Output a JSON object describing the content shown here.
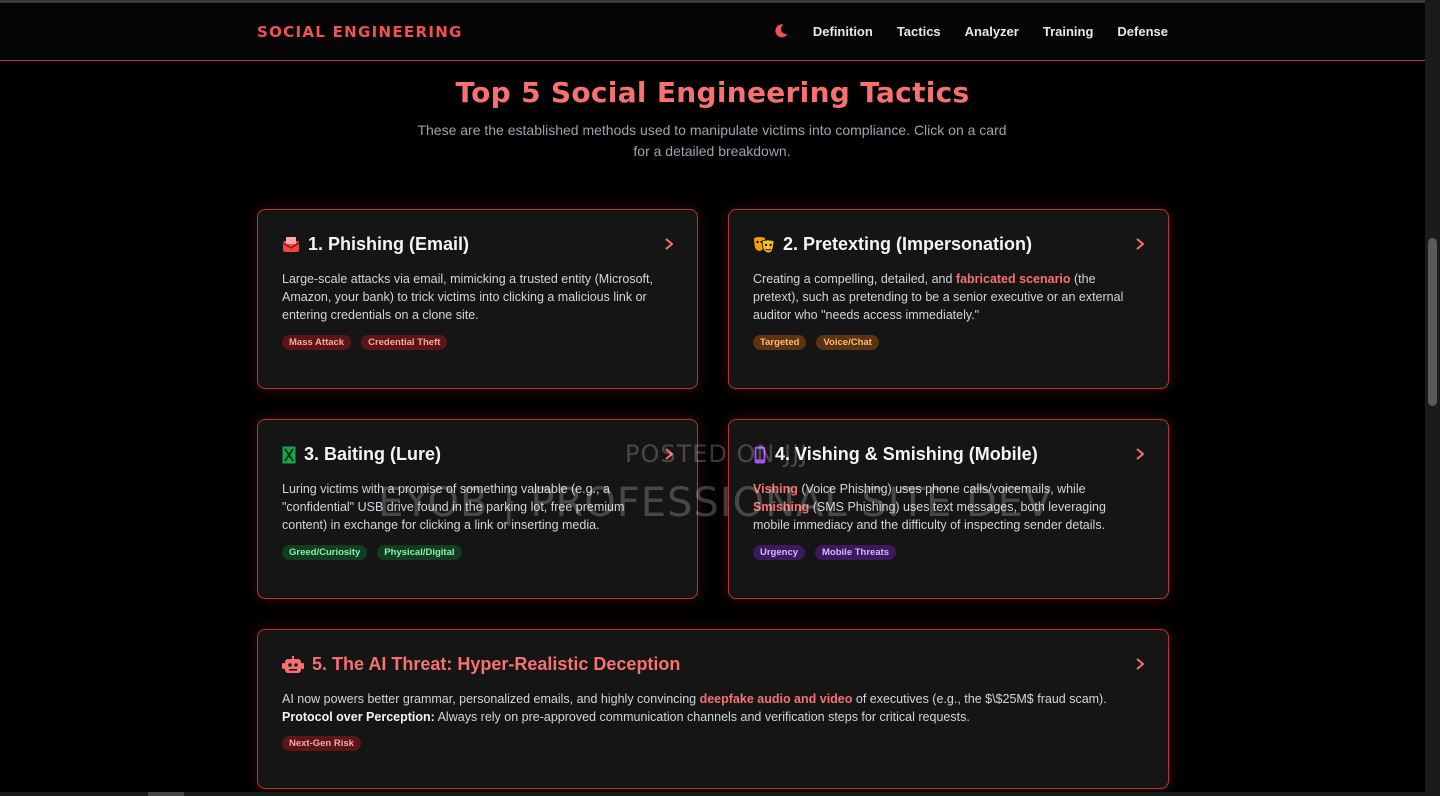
{
  "brand": "SOCIAL ENGINEERING",
  "nav": {
    "theme_toggle_icon": "moon-icon",
    "items": [
      "Definition",
      "Tactics",
      "Analyzer",
      "Training",
      "Defense"
    ]
  },
  "section": {
    "title": "Top 5 Social Engineering Tactics",
    "subtitle": "These are the established methods used to manipulate victims into compliance. Click on a card for a detailed breakdown."
  },
  "cards": [
    {
      "icon": "envelope-icon",
      "title": "1. Phishing (Email)",
      "body": "Large-scale attacks via email, mimicking a trusted entity (Microsoft, Amazon, your bank) to trick victims into clicking a malicious link or entering credentials on a clone site.",
      "tags": [
        "Mass Attack",
        "Credential Theft"
      ]
    },
    {
      "icon": "theater-masks-icon",
      "title": "2. Pretexting (Impersonation)",
      "body_pre": "Creating a compelling, detailed, and ",
      "body_hl": "fabricated scenario",
      "body_post": " (the pretext), such as pretending to be a senior executive or an external auditor who \"needs access immediately.\"",
      "tags": [
        "Targeted",
        "Voice/Chat"
      ]
    },
    {
      "icon": "usb-lure-icon",
      "title": "3. Baiting (Lure)",
      "body": "Luring victims with a promise of something valuable (e.g., a \"confidential\" USB drive found in the parking lot, free premium content) in exchange for clicking a link or inserting media.",
      "tags": [
        "Greed/Curiosity",
        "Physical/Digital"
      ]
    },
    {
      "icon": "mobile-phone-icon",
      "title": "4. Vishing & Smishing (Mobile)",
      "body_hl1": "Vishing",
      "body_mid1": " (Voice Phishing) uses phone calls/voicemails, while ",
      "body_hl2": "Smishing",
      "body_mid2": " (SMS Phishing) uses text messages, both leveraging mobile immediacy and the difficulty of inspecting sender details.",
      "tags": [
        "Urgency",
        "Mobile Threats"
      ]
    },
    {
      "icon": "robot-icon",
      "title": "5. The AI Threat: Hyper-Realistic Deception",
      "body_pre": "AI now powers better grammar, personalized emails, and highly convincing ",
      "body_hl": "deepfake audio and video",
      "body_post": " of executives (e.g., the $\\$25M$ fraud scam).",
      "body_strong": "Protocol over Perception:",
      "body_tail": " Always rely on pre-approved communication channels and verification steps for critical requests.",
      "tags": [
        "Next-Gen Risk"
      ]
    }
  ],
  "watermark": {
    "line1": "POSTED ON JJJ",
    "line2": "EYOB | PROFESSIONAL SITE DEV"
  },
  "colors": {
    "accent": "#f87171",
    "border": "#b33636",
    "background": "#000000",
    "card": "#151515"
  }
}
